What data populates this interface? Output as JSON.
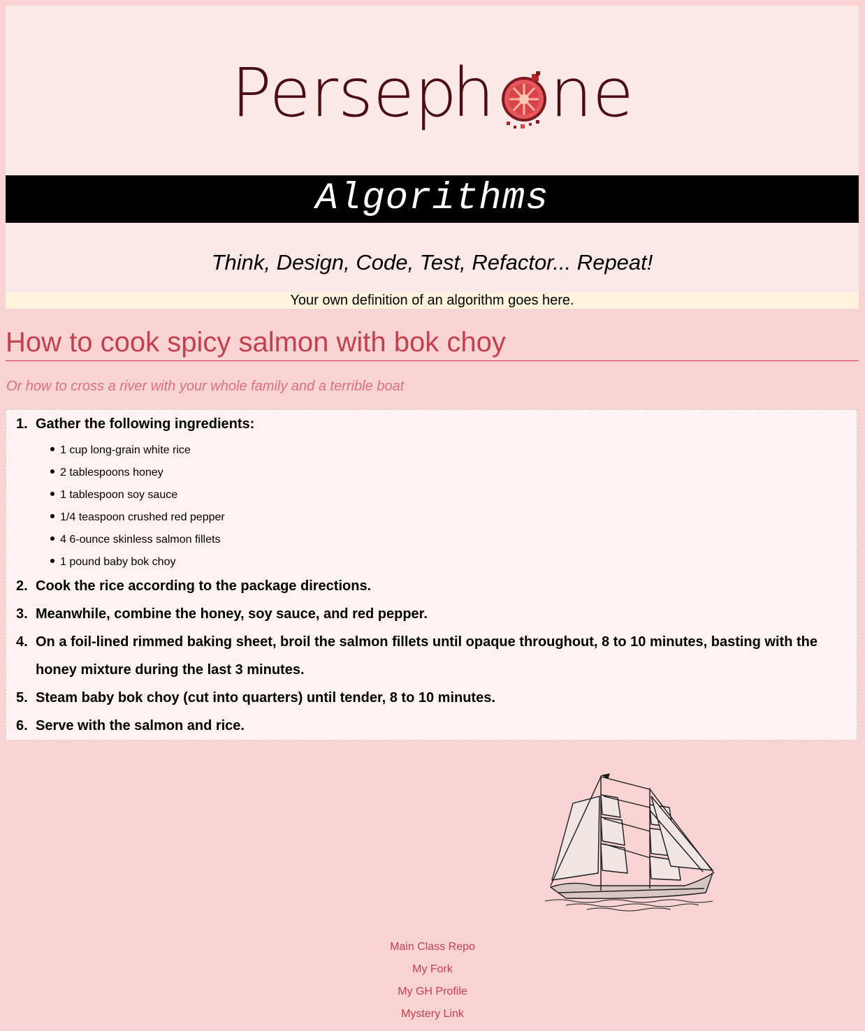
{
  "header": {
    "logo_text_left": "Persep",
    "logo_text_h": "h",
    "logo_text_right": "ne",
    "banner_title": "Algorithms",
    "tagline": "Think, Design, Code, Test, Refactor... Repeat!",
    "definition": "Your own definition of an algorithm goes here."
  },
  "recipe": {
    "title": "How to cook spicy salmon with bok choy",
    "subtitle": "Or how to cross a river with your whole family and a terrible boat",
    "steps": [
      {
        "num": "1.",
        "text": "Gather the following ingredients:",
        "ingredients": [
          "1 cup long-grain white rice",
          "2 tablespoons honey",
          "1 tablespoon soy sauce",
          "1/4 teaspoon crushed red pepper",
          "4 6-ounce skinless salmon fillets",
          "1 pound baby bok choy"
        ]
      },
      {
        "num": "2.",
        "text": "Cook the rice according to the package directions."
      },
      {
        "num": "3.",
        "text": "Meanwhile, combine the honey, soy sauce, and red pepper."
      },
      {
        "num": "4.",
        "text": "On a foil-lined rimmed baking sheet, broil the salmon fillets until opaque throughout, 8 to 10 minutes, basting with the honey mixture during the last 3 minutes."
      },
      {
        "num": "5.",
        "text": "Steam baby bok choy (cut into quarters) until tender, 8 to 10 minutes."
      },
      {
        "num": "6.",
        "text": "Serve with the salmon and rice."
      }
    ]
  },
  "footer": {
    "links": [
      "Main Class Repo",
      "My Fork",
      "My GH Profile",
      "Mystery Link"
    ]
  },
  "colors": {
    "page_bg": "#f8d3d3",
    "header_bg": "#fbe9e8",
    "banner_bg": "#000000",
    "definition_bg": "#fdf3dc",
    "accent": "#c2414f",
    "subtitle": "#d97180",
    "logo": "#4a0e12"
  }
}
